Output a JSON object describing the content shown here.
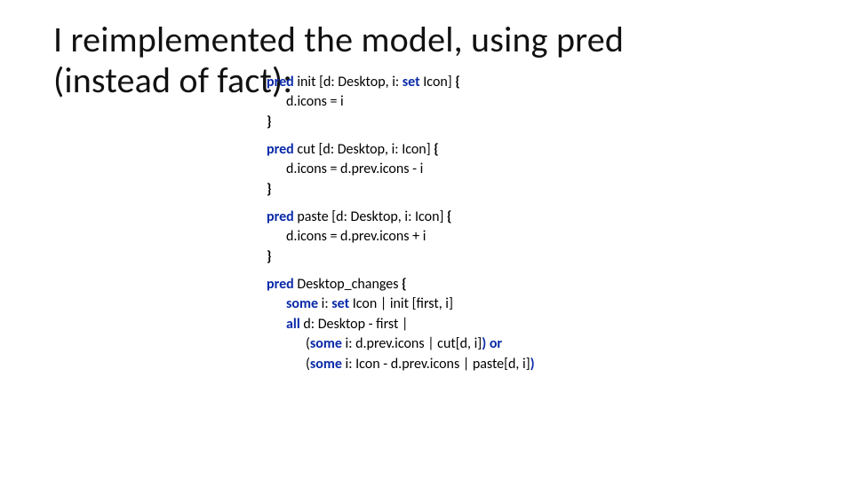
{
  "title_line1": "I reimplemented the model, using pred",
  "title_line2": "(instead of fact):",
  "code": {
    "k_pred": "pred",
    "k_set": "set",
    "k_some": "some",
    "k_all": "all",
    "k_or": "or",
    "init_name": " init ",
    "init_sig": "[d: Desktop, i: ",
    "init_sig_tail": " Icon] ",
    "init_body": "d.icons = i",
    "cut_name": " cut ",
    "cut_sig": "[d: Desktop, i: Icon] ",
    "cut_body": "d.icons = d.prev.icons - i",
    "paste_name": " paste ",
    "paste_sig": "[d: Desktop, i: Icon] ",
    "paste_body": "d.icons = d.prev.icons + i",
    "dc_name": " Desktop_changes ",
    "dc_l1_a": " i: ",
    "dc_l1_b": " Icon | init [first, i]",
    "dc_l2_a": " d: Desktop - first |",
    "dc_l3_a": "(",
    "dc_l3_b": " i: d.prev.icons | cut[d, i]",
    "dc_l3_c": ")",
    "dc_l4_a": "(",
    "dc_l4_b": " i: Icon - d.prev.icons | paste[d, i]",
    "dc_l4_c": ")",
    "lbrace": "{",
    "rbrace": "}"
  }
}
